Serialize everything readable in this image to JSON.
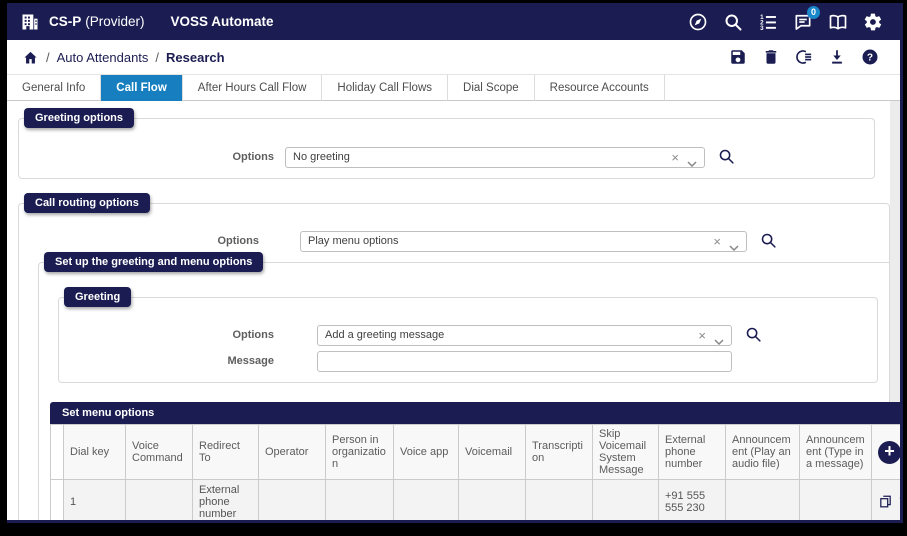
{
  "topbar": {
    "org_name": "CS-P",
    "org_suffix": "(Provider)",
    "product": "VOSS Automate",
    "chat_badge_count": "0"
  },
  "breadcrumb": {
    "separator": "/",
    "items": [
      "Auto Attendants",
      "Research"
    ]
  },
  "tabs": {
    "items": [
      "General Info",
      "Call Flow",
      "After Hours Call Flow",
      "Holiday Call Flows",
      "Dial Scope",
      "Resource Accounts"
    ],
    "active": "Call Flow"
  },
  "greeting_options": {
    "title": "Greeting options",
    "options_label": "Options",
    "options_value": "No greeting"
  },
  "call_routing": {
    "title": "Call routing options",
    "options_label": "Options",
    "options_value": "Play menu options"
  },
  "setup_section": {
    "title": "Set up the greeting and menu options"
  },
  "greeting_section": {
    "title": "Greeting",
    "options_label": "Options",
    "options_value": "Add a greeting message",
    "message_label": "Message",
    "message_value": ""
  },
  "menu_table": {
    "title": "Set menu options",
    "columns": [
      "Dial key",
      "Voice Command",
      "Redirect To",
      "Operator",
      "Person in organization",
      "Voice app",
      "Voicemail",
      "Transcription",
      "Skip Voicemail System Message",
      "External phone number",
      "Announcement (Play an audio file)",
      "Announcement (Type in a message)"
    ],
    "rows": [
      {
        "dial_key": "1",
        "voice_command": "",
        "redirect_to": "External phone number",
        "operator": "",
        "person_in_organization": "",
        "voice_app": "",
        "voicemail": "",
        "transcription": "",
        "skip_voicemail_system_message": "",
        "external_phone_number": "+91 555 555 230",
        "announcement_audio": "",
        "announcement_message": ""
      }
    ]
  },
  "colors": {
    "navy": "#1b1d52",
    "active_tab_blue": "#177fc0",
    "notification_badge_blue": "#1a87ca"
  }
}
